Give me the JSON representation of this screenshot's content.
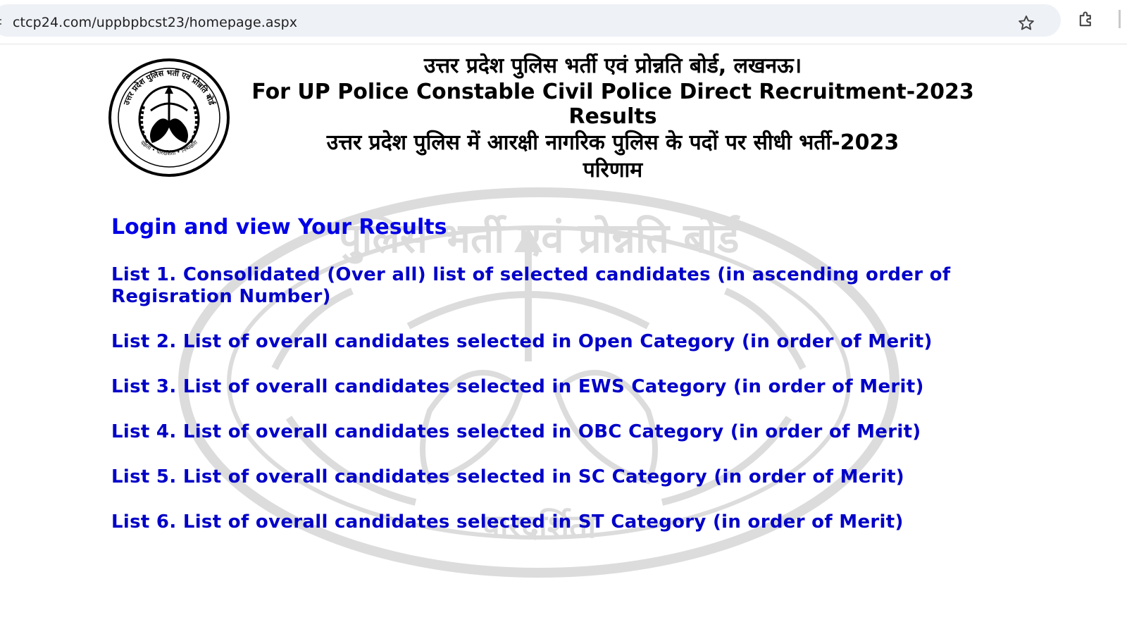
{
  "browser": {
    "url": "ctcp24.com/uppbpbcst23/homepage.aspx",
    "icons": [
      "site-info-icon",
      "bookmark-star-icon",
      "extensions-icon"
    ]
  },
  "header": {
    "board_hindi": "उत्तर प्रदेश पुलिस भर्ती एवं प्रोन्नति बोर्ड, लखनऊ।",
    "title_en_line1": "For UP Police Constable Civil Police Direct Recruitment-2023",
    "title_en_line2": "Results",
    "title_hindi_line1": "उत्तर प्रदेश पुलिस में आरक्षी नागरिक पुलिस के पदों पर सीधी भर्ती-2023",
    "title_hindi_line2": "परिणाम"
  },
  "seal": {
    "text_top": "उत्तर प्रदेश पुलिस भर्ती एवं प्रोन्नति बोर्ड",
    "text_bottom": "दक्षता • पारदर्शिता • निष्पक्षता"
  },
  "links": {
    "login": "Login and view Your Results",
    "list1": "List 1. Consolidated (Over all) list of selected candidates (in ascending order of Regisration Number)",
    "list2": "List 2. List of overall candidates selected in Open Category (in order of Merit)",
    "list3": "List 3. List of overall candidates selected in EWS Category (in order of Merit)",
    "list4": "List 4. List of overall candidates selected in OBC Category (in order of Merit)",
    "list5": "List 5. List of overall candidates selected in SC Category (in order of Merit)",
    "list6": "List 6. List of overall candidates selected in ST Category (in order of Merit)"
  },
  "colors": {
    "link_blue": "#0000e6",
    "text_black": "#000000",
    "omnibox_bg": "#eef1f6"
  }
}
